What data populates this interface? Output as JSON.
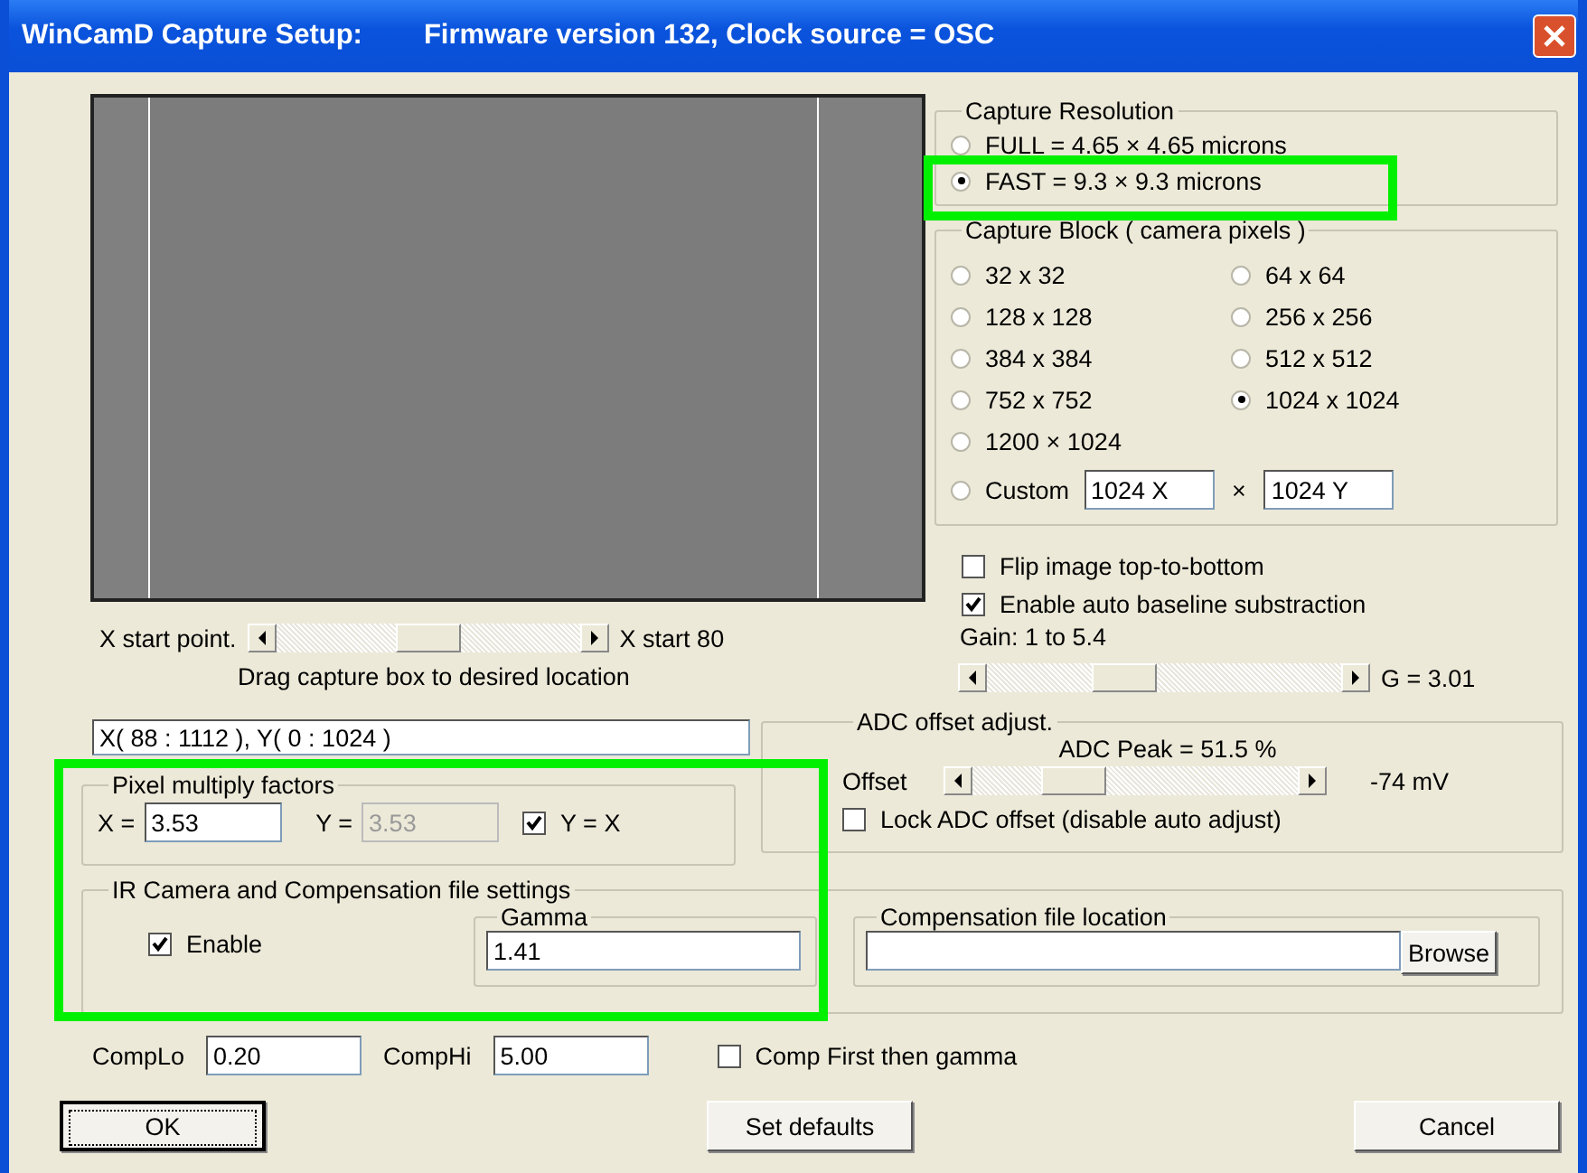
{
  "window": {
    "title": "WinCamD Capture Setup:",
    "subtitle": "Firmware version 132,  Clock source = OSC"
  },
  "x_start": {
    "label": "X start point.",
    "level": 0.5,
    "reading": "X start 80"
  },
  "drag_caption": "Drag capture box to desired location",
  "capture_range": {
    "value": "X( 88 : 1112 ), Y( 0 : 1024 )"
  },
  "pixel_multiply": {
    "title": "Pixel multiply factors",
    "x_label": "X =",
    "x_value": "3.53",
    "y_label": "Y =",
    "y_value": "3.53",
    "y_disabled": true,
    "lock": {
      "label": "Y = X",
      "checked": true
    }
  },
  "capture_resolution": {
    "title": "Capture Resolution",
    "options": [
      {
        "label": "FULL = 4.65 × 4.65 microns",
        "selected": false
      },
      {
        "label": "FAST = 9.3 × 9.3 microns",
        "selected": true
      }
    ]
  },
  "capture_block": {
    "title": "Capture Block ( camera pixels )",
    "options": [
      {
        "label": "32 x 32",
        "selected": false
      },
      {
        "label": "64 x 64",
        "selected": false
      },
      {
        "label": "128 x 128",
        "selected": false
      },
      {
        "label": "256 x 256",
        "selected": false
      },
      {
        "label": "384 x 384",
        "selected": false
      },
      {
        "label": "512 x 512",
        "selected": false
      },
      {
        "label": "752 x 752",
        "selected": false
      },
      {
        "label": "1024 x 1024",
        "selected": true
      },
      {
        "label": "1200 × 1024",
        "selected": false
      }
    ],
    "custom": {
      "label": "Custom",
      "selected": false,
      "x_value": "1024 X",
      "separator": "×",
      "y_value": "1024 Y"
    }
  },
  "checkboxes": [
    {
      "label": "Flip image top-to-bottom",
      "checked": false
    },
    {
      "label": "Enable auto baseline substraction",
      "checked": true
    }
  ],
  "gain": {
    "label": "Gain:  1 to 5.4",
    "level": 0.39,
    "reading": "G = 3.01"
  },
  "adc": {
    "title": "ADC offset adjust.",
    "peak": "ADC Peak = 51.5 %",
    "offset_label": "Offset",
    "level": 0.31,
    "reading": "-74 mV",
    "lock": {
      "label": "Lock ADC offset  (disable auto adjust)",
      "checked": false
    }
  },
  "ir": {
    "title": "IR Camera and Compensation file settings",
    "enable": {
      "label": "Enable",
      "checked": true
    },
    "gamma": {
      "title": "Gamma",
      "value": "1.41"
    },
    "comp_file": {
      "title": "Compensation file location",
      "button": "Browse"
    }
  },
  "comp": {
    "lo_label": "CompLo",
    "lo_value": "0.20",
    "hi_label": "CompHi",
    "hi_value": "5.00",
    "first": {
      "label": "Comp First then gamma",
      "checked": false
    }
  },
  "buttons": [
    {
      "label": "OK",
      "default": true
    },
    {
      "label": "Set defaults",
      "default": false
    },
    {
      "label": "Cancel",
      "default": false
    }
  ]
}
